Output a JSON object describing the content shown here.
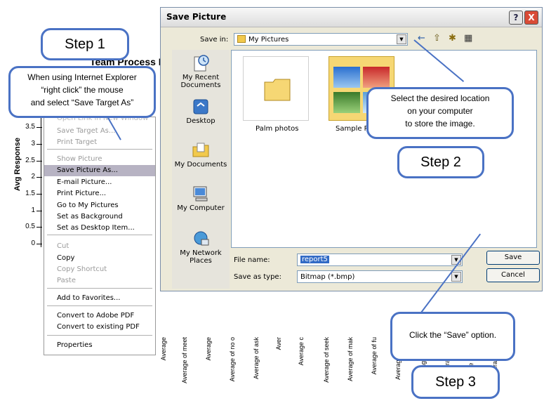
{
  "background": {
    "chart_title": "Team Process E",
    "y_axis_label": "Avg Response",
    "y_ticks": [
      "3.5",
      "3",
      "2.5",
      "2",
      "1.5",
      "1",
      "0.5",
      "0"
    ],
    "x_labels": [
      "Average",
      "Average of meet",
      "Average",
      "Average of no o",
      "Average of ask",
      "Aver",
      "Average c",
      "Average of seek",
      "Average of mak",
      "Average of fu",
      "Average of proj",
      "Average of achi",
      "Average of ac",
      "Average of genera",
      "Average of kin"
    ]
  },
  "context_menu": {
    "items": [
      {
        "label": "Open Link in New Window",
        "disabled": false
      },
      {
        "label": "Save Target As...",
        "disabled": true
      },
      {
        "label": "Print Target",
        "disabled": true
      },
      {
        "label": "Show Picture",
        "disabled": true
      },
      {
        "label": "Save Picture As...",
        "disabled": false,
        "selected": true
      },
      {
        "label": "E-mail Picture...",
        "disabled": false
      },
      {
        "label": "Print Picture...",
        "disabled": false
      },
      {
        "label": "Go to My Pictures",
        "disabled": false
      },
      {
        "label": "Set as Background",
        "disabled": false
      },
      {
        "label": "Set as Desktop Item...",
        "disabled": false
      },
      {
        "label": "Cut",
        "disabled": true
      },
      {
        "label": "Copy",
        "disabled": false
      },
      {
        "label": "Copy Shortcut",
        "disabled": true
      },
      {
        "label": "Paste",
        "disabled": true
      },
      {
        "label": "Add to Favorites...",
        "disabled": false
      },
      {
        "label": "Convert to Adobe PDF",
        "disabled": false
      },
      {
        "label": "Convert to existing PDF",
        "disabled": false
      },
      {
        "label": "Properties",
        "disabled": false
      }
    ]
  },
  "dialog": {
    "title": "Save Picture",
    "help_label": "?",
    "close_label": "X",
    "save_in_label": "Save in:",
    "save_in_value": "My Pictures",
    "places": [
      {
        "label": "My Recent Documents",
        "icon": "recent-documents-icon"
      },
      {
        "label": "Desktop",
        "icon": "desktop-icon"
      },
      {
        "label": "My Documents",
        "icon": "my-documents-icon"
      },
      {
        "label": "My Computer",
        "icon": "my-computer-icon"
      },
      {
        "label": "My Network Places",
        "icon": "network-places-icon"
      }
    ],
    "files": [
      {
        "label": "Palm photos"
      },
      {
        "label": "Sample Pictures"
      }
    ],
    "file_name_label": "File name:",
    "file_name_value": "report5",
    "save_as_type_label": "Save as type:",
    "save_as_type_value": "Bitmap (*.bmp)",
    "save_button": "Save",
    "cancel_button": "Cancel"
  },
  "callouts": {
    "step1": "Step 1",
    "step1_note_line1": "When using Internet Explorer",
    "step1_note_line2": "“right click” the mouse",
    "step1_note_line3": "and select “Save Target As”",
    "step2": "Step 2",
    "step2_note_line1": "Select the desired location",
    "step2_note_line2": "on your computer",
    "step2_note_line3": "to store the image.",
    "step3": "Step 3",
    "step3_note": "Click the “Save” option."
  },
  "colors": {
    "callout_border": "#4a72c4",
    "menu_highlight": "#b7b3c3",
    "dialog_bg": "#ece9d8"
  }
}
